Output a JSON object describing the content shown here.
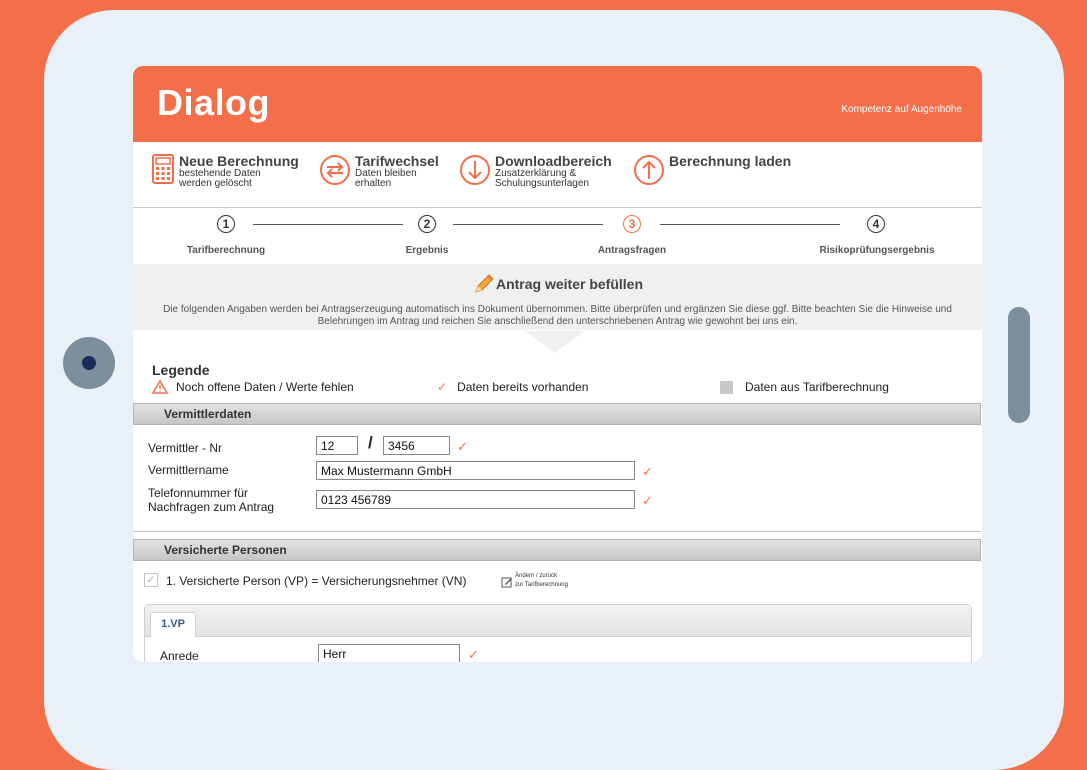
{
  "brand": {
    "logo": "Dialog",
    "tagline": "Kompetenz auf Augenhöhe"
  },
  "nav": [
    {
      "title": "Neue Berechnung",
      "sub1": "bestehende Daten",
      "sub2": "werden gelöscht"
    },
    {
      "title": "Tarifwechsel",
      "sub1": "Daten bleiben",
      "sub2": "erhalten"
    },
    {
      "title": "Downloadbereich",
      "sub1": "Zusatzerklärung &",
      "sub2": "Schulungsunterlagen"
    },
    {
      "title": "Berechnung laden",
      "sub1": "",
      "sub2": ""
    }
  ],
  "steps": [
    {
      "num": "1",
      "label": "Tarifberechnung"
    },
    {
      "num": "2",
      "label": "Ergebnis"
    },
    {
      "num": "3",
      "label": "Antragsfragen"
    },
    {
      "num": "4",
      "label": "Risikoprüfungsergebnis"
    }
  ],
  "intro": {
    "title": "Antrag weiter befüllen",
    "text": "Die folgenden Angaben werden bei Antragserzeugung automatisch ins Dokument übernommen. Bitte überprüfen und ergänzen Sie diese ggf. Bitte beachten Sie die Hinweise und Belehrungen im Antrag und reichen Sie anschließend den unterschriebenen Antrag wie gewohnt bei uns ein."
  },
  "legend": {
    "title": "Legende",
    "missing": "Noch offene Daten / Werte fehlen",
    "present": "Daten bereits vorhanden",
    "from_calc": "Daten aus Tarifberechnung"
  },
  "vermittler": {
    "section": "Vermittlerdaten",
    "nr_label": "Vermittler - Nr",
    "nr_part1": "12",
    "separator": "/",
    "nr_part2": "3456",
    "name_label": "Vermittlername",
    "name_value": "Max Mustermann GmbH",
    "phone_label1": "Telefonnummer für",
    "phone_label2": "Nachfragen zum Antrag",
    "phone_value": "0123 456789"
  },
  "persons": {
    "section": "Versicherte Personen",
    "vp_label": "1. Versicherte Person (VP) = Versicherungsnehmer (VN)",
    "change_line1": "Ändern / zurück",
    "change_line2": "zur Tarifberechnung",
    "tab": "1.VP",
    "anrede_label": "Anrede",
    "anrede_value": "Herr"
  },
  "colors": {
    "accent": "#f26f4a",
    "background": "#e9f0f7"
  }
}
